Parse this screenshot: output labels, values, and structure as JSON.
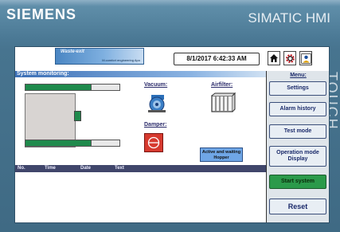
{
  "bezel": {
    "brand": "SIEMENS",
    "product": "SIMATIC HMI",
    "side_label": "TOUCH"
  },
  "header": {
    "logo_main": "Waste-exit",
    "logo_sub": "M.comfort engineering Apo",
    "datetime": "8/1/2017 6:42:33 AM"
  },
  "section_title": "System monitoring:",
  "diagram": {
    "vacuum_label": "Vacuum:",
    "airfilter_label": "Airfilter:",
    "damper_label": "Damper:",
    "hopper_status": "Active and waiting Hopper",
    "bars": {
      "top_fill": 0.7,
      "bottom_fill": 0.7,
      "right_fill": 1.0
    }
  },
  "alarm_table": {
    "columns": [
      "No.",
      "Time",
      "Date",
      "Text"
    ]
  },
  "menu": {
    "title": "Menu:",
    "buttons": [
      {
        "label": "Settings"
      },
      {
        "label": "Alarm history"
      },
      {
        "label": "Test mode"
      },
      {
        "label": "Operation mode Display"
      },
      {
        "label": "Start system"
      },
      {
        "label": "Reset"
      }
    ]
  },
  "icons": {
    "home": "home-icon",
    "settings": "gear-icon",
    "user": "user-icon",
    "vacuum": "vacuum-pump-icon",
    "airfilter": "air-filter-icon",
    "damper": "damper-icon"
  },
  "colors": {
    "status_green": "#1f8a4c",
    "damper_red": "#d63a2f",
    "start_button": "#2b9a4a"
  }
}
